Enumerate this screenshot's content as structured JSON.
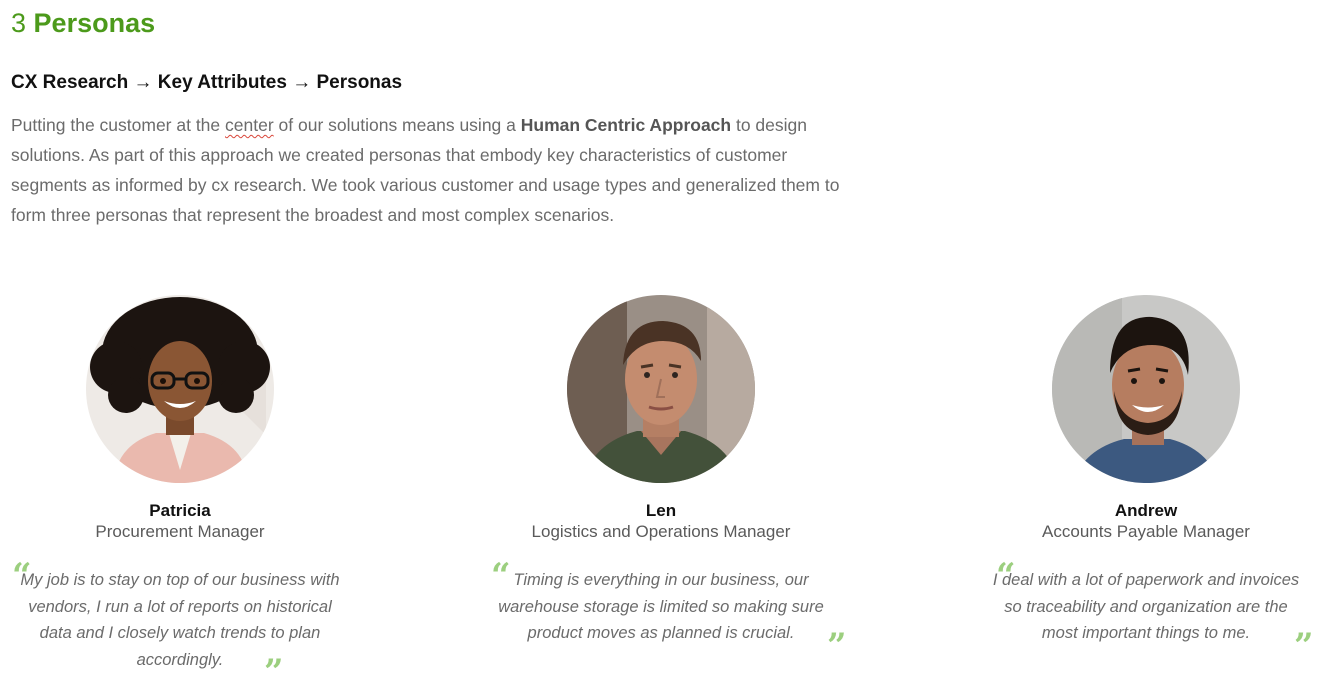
{
  "section": {
    "number": "3",
    "title": "Personas"
  },
  "flow": {
    "text": "CX Research → Key Attributes → Personas"
  },
  "intro": {
    "part1": "Putting the customer at the ",
    "underlined": "center",
    "part2": " of our solutions means using a ",
    "bold": "Human Centric Approach",
    "part3": " to design solutions. As part of this approach we created personas that embody key characteristics of customer segments as informed by cx research. We took various customer and usage types and generalized them to form three personas that represent the broadest and most complex scenarios."
  },
  "quote_marks": {
    "open": "“",
    "close": "”"
  },
  "personas": [
    {
      "name": "Patricia",
      "role": "Procurement Manager",
      "quote": "My job is to stay on top of our business with vendors, I run a lot of reports on historical data and I closely watch trends to plan accordingly.",
      "avatar": "avatar-patricia"
    },
    {
      "name": "Len",
      "role": "Logistics and Operations Manager",
      "quote": "Timing is everything in our business, our warehouse storage is limited so making sure product moves as planned is crucial.",
      "avatar": "avatar-len"
    },
    {
      "name": "Andrew",
      "role": "Accounts Payable Manager",
      "quote": "I deal with a lot of paperwork and invoices so traceability and organization are the most important things to me.",
      "avatar": "avatar-andrew"
    }
  ],
  "colors": {
    "accent": "#4c9a1b",
    "quote_mark": "#9ccf7f",
    "body_text": "#6b6b6b"
  }
}
